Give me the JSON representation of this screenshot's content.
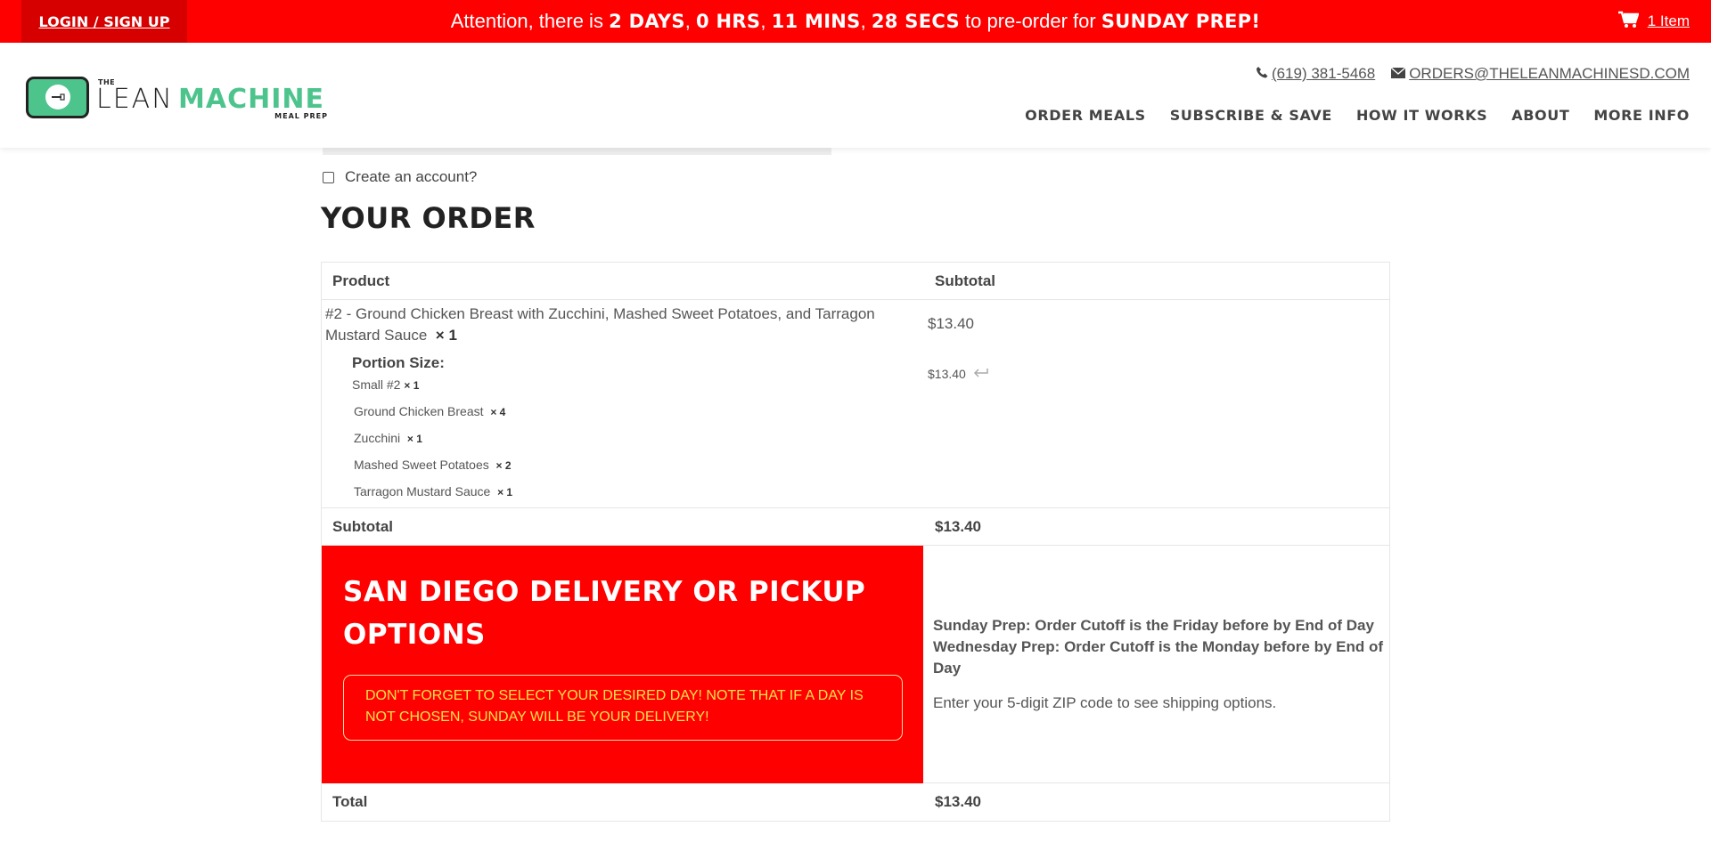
{
  "topbar": {
    "login_label": "LOGIN / SIGN UP",
    "announce_pre": "Attention, there is ",
    "days": "2 DAYS",
    "sep1": ", ",
    "hrs": "0 HRS",
    "sep2": ", ",
    "mins": "11 MINS",
    "sep3": ", ",
    "secs": "28 SECS",
    "announce_mid": " to pre-order for ",
    "prep": "SUNDAY PREP!",
    "cart_label": "1 Item",
    "bar_color": "#ff0000"
  },
  "header": {
    "logo_the": "THE",
    "logo_lean": "LEAN",
    "logo_machine": "MACHINE",
    "logo_meal": "MEAL PREP",
    "phone": "(619) 381-5468",
    "email": "ORDERS@THELEANMACHINESD.COM",
    "nav": [
      "ORDER MEALS",
      "SUBSCRIBE & SAVE",
      "HOW IT WORKS",
      "ABOUT",
      "MORE INFO"
    ],
    "brand_green": "#4ec48d"
  },
  "checkout": {
    "create_account": "Create an account?",
    "title": "YOUR ORDER",
    "col_product": "Product",
    "col_subtotal": "Subtotal",
    "product_name": "#2 - Ground Chicken Breast with Zucchini, Mashed Sweet Potatoes, and Tarragon Mustard Sauce",
    "product_qty": "× 1",
    "product_price": "$13.40",
    "portion_label": "Portion Size:",
    "portion_value": "Small #2",
    "portion_qty": "× 1",
    "portion_price": "$13.40",
    "components": [
      {
        "name": "Ground Chicken Breast",
        "qty": "× 4"
      },
      {
        "name": "Zucchini",
        "qty": "× 1"
      },
      {
        "name": "Mashed Sweet Potatoes",
        "qty": "× 2"
      },
      {
        "name": "Tarragon Mustard Sauce",
        "qty": "× 1"
      }
    ],
    "subtotal_label": "Subtotal",
    "subtotal_value": "$13.40",
    "delivery_title": "SAN DIEGO DELIVERY OR PICKUP OPTIONS",
    "delivery_notice": "DON'T FORGET TO SELECT YOUR DESIRED DAY! NOTE THAT IF A DAY IS NOT CHOSEN, SUNDAY WILL BE YOUR DELIVERY!",
    "cutoff_sunday": "Sunday Prep: Order Cutoff is the Friday before by End of Day",
    "cutoff_wednesday": "Wednesday Prep: Order Cutoff is the Monday before by End of Day",
    "zip_hint": "Enter your 5-digit ZIP code to see shipping options.",
    "total_label": "Total",
    "total_value": "$13.40"
  }
}
